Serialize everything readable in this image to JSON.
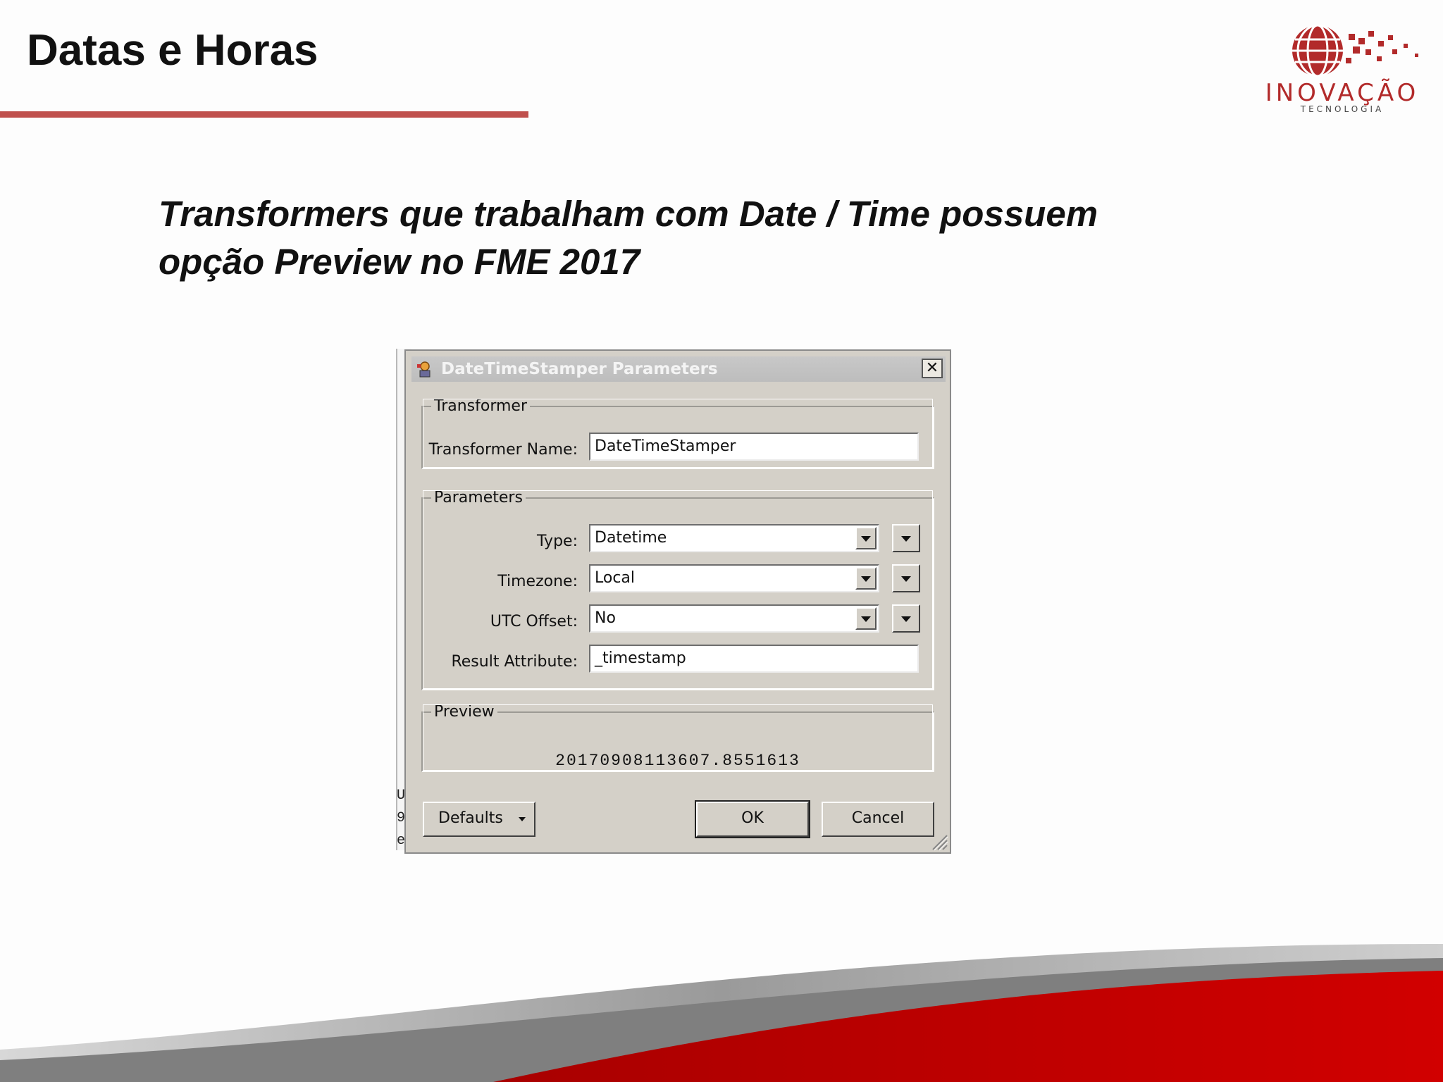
{
  "slide": {
    "title": "Datas e Horas",
    "subtitle_line1": "Transformers que trabalham com Date / Time possuem",
    "subtitle_line2": "opção Preview no FME 2017"
  },
  "logo": {
    "word": "INOVAÇÃO",
    "sub": "TECNOLOGIA"
  },
  "colors": {
    "accent_red": "#c0504d",
    "brand_red": "#c00000",
    "dialog_bg": "#d4d0c8"
  },
  "background_window": {
    "fragments": [
      "U",
      "9",
      "e"
    ]
  },
  "dialog": {
    "title": "DateTimeStamper Parameters",
    "close_glyph": "✕",
    "transformer_group": {
      "legend": "Transformer",
      "name_label": "Transformer Name:",
      "name_value": "DateTimeStamper"
    },
    "parameters_group": {
      "legend": "Parameters",
      "type_label": "Type:",
      "type_value": "Datetime",
      "timezone_label": "Timezone:",
      "timezone_value": "Local",
      "utc_offset_label": "UTC Offset:",
      "utc_offset_value": "No",
      "result_attribute_label": "Result Attribute:",
      "result_attribute_value": "_timestamp"
    },
    "preview_group": {
      "legend": "Preview",
      "value": "20170908113607.8551613"
    },
    "buttons": {
      "defaults": "Defaults",
      "ok": "OK",
      "cancel": "Cancel"
    }
  }
}
